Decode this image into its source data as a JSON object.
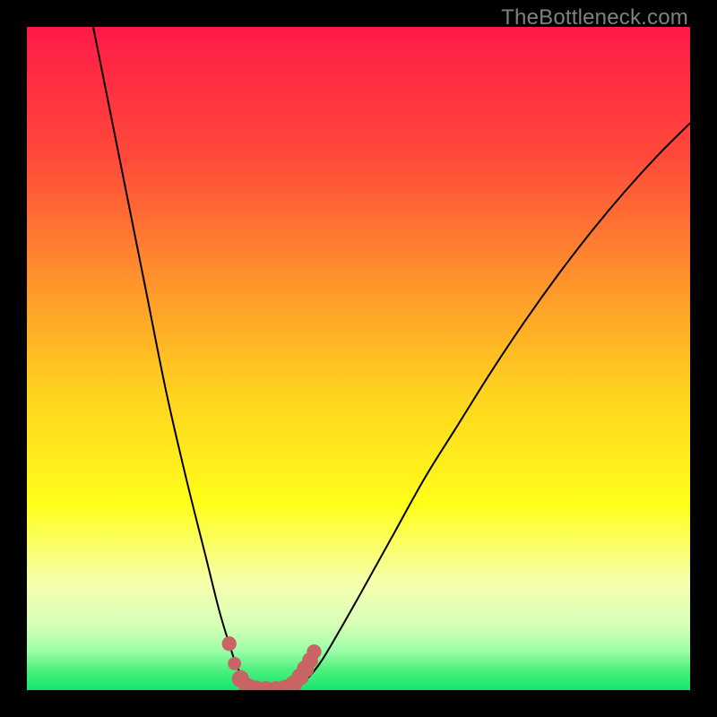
{
  "watermark": "TheBottleneck.com",
  "chart_data": {
    "type": "line",
    "title": "",
    "xlabel": "",
    "ylabel": "",
    "xlim": [
      0,
      100
    ],
    "ylim": [
      0,
      100
    ],
    "gradient_stops": [
      {
        "offset": 0.0,
        "color": "#ff1a47"
      },
      {
        "offset": 0.2,
        "color": "#ff4b3a"
      },
      {
        "offset": 0.4,
        "color": "#ff9a2a"
      },
      {
        "offset": 0.55,
        "color": "#ffd21f"
      },
      {
        "offset": 0.72,
        "color": "#ffff1a"
      },
      {
        "offset": 0.84,
        "color": "#f6ffb0"
      },
      {
        "offset": 0.9,
        "color": "#d8ffb8"
      },
      {
        "offset": 0.94,
        "color": "#9effa8"
      },
      {
        "offset": 0.97,
        "color": "#4cf07e"
      },
      {
        "offset": 1.0,
        "color": "#12e66b"
      }
    ],
    "series": [
      {
        "name": "left-branch",
        "points": [
          {
            "x": 10.0,
            "y": 100.0
          },
          {
            "x": 12.0,
            "y": 90.0
          },
          {
            "x": 15.0,
            "y": 75.0
          },
          {
            "x": 18.0,
            "y": 60.0
          },
          {
            "x": 21.0,
            "y": 45.0
          },
          {
            "x": 24.0,
            "y": 32.0
          },
          {
            "x": 27.0,
            "y": 20.0
          },
          {
            "x": 29.0,
            "y": 12.0
          },
          {
            "x": 30.5,
            "y": 7.0
          },
          {
            "x": 31.5,
            "y": 4.0
          },
          {
            "x": 32.5,
            "y": 2.0
          },
          {
            "x": 33.5,
            "y": 0.8
          },
          {
            "x": 34.5,
            "y": 0.2
          },
          {
            "x": 36.0,
            "y": 0.0
          },
          {
            "x": 38.0,
            "y": 0.0
          }
        ]
      },
      {
        "name": "right-branch",
        "points": [
          {
            "x": 38.0,
            "y": 0.0
          },
          {
            "x": 40.0,
            "y": 0.4
          },
          {
            "x": 42.0,
            "y": 1.5
          },
          {
            "x": 44.0,
            "y": 3.8
          },
          {
            "x": 46.0,
            "y": 7.0
          },
          {
            "x": 50.0,
            "y": 14.0
          },
          {
            "x": 55.0,
            "y": 23.0
          },
          {
            "x": 60.0,
            "y": 32.0
          },
          {
            "x": 65.0,
            "y": 40.0
          },
          {
            "x": 70.0,
            "y": 48.0
          },
          {
            "x": 75.0,
            "y": 55.5
          },
          {
            "x": 80.0,
            "y": 62.5
          },
          {
            "x": 85.0,
            "y": 69.0
          },
          {
            "x": 90.0,
            "y": 75.0
          },
          {
            "x": 95.0,
            "y": 80.5
          },
          {
            "x": 100.0,
            "y": 85.5
          }
        ]
      }
    ],
    "markers": [
      {
        "x": 30.5,
        "y": 7.0,
        "r": 1.1
      },
      {
        "x": 31.3,
        "y": 4.0,
        "r": 1.0
      },
      {
        "x": 32.2,
        "y": 1.7,
        "r": 1.3
      },
      {
        "x": 33.3,
        "y": 0.5,
        "r": 1.3
      },
      {
        "x": 34.5,
        "y": 0.15,
        "r": 1.3
      },
      {
        "x": 36.0,
        "y": 0.05,
        "r": 1.3
      },
      {
        "x": 37.5,
        "y": 0.05,
        "r": 1.3
      },
      {
        "x": 39.0,
        "y": 0.25,
        "r": 1.3
      },
      {
        "x": 40.2,
        "y": 0.9,
        "r": 1.3
      },
      {
        "x": 41.2,
        "y": 2.0,
        "r": 1.3
      },
      {
        "x": 42.0,
        "y": 3.2,
        "r": 1.3
      },
      {
        "x": 42.7,
        "y": 4.5,
        "r": 1.2
      },
      {
        "x": 43.3,
        "y": 5.8,
        "r": 1.1
      }
    ],
    "marker_color": "#c86464",
    "curve_color": "#000000",
    "curve_width": 2.0
  }
}
